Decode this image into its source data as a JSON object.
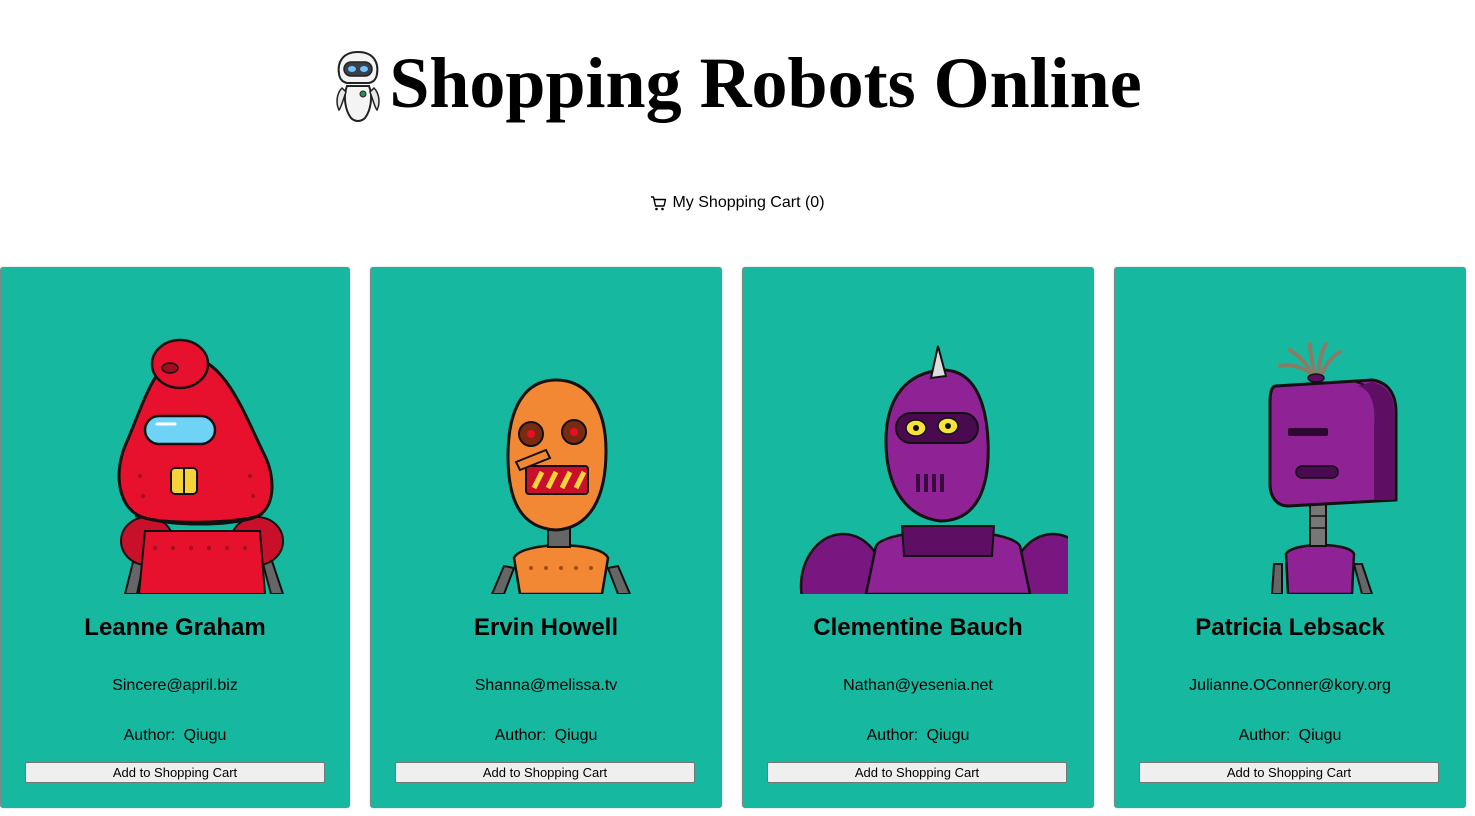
{
  "header": {
    "title": "Shopping Robots Online",
    "logo_icon": "robot-logo-icon"
  },
  "cart": {
    "label": "My Shopping Cart (0)",
    "icon": "shopping-cart-icon"
  },
  "colors": {
    "card_background": "#16b8a0",
    "robot_red": "#e8112d",
    "robot_orange": "#f28834",
    "robot_purple": "#8a1a8a"
  },
  "robots": [
    {
      "name": "Leanne Graham",
      "email": "Sincere@april.biz",
      "author_label": "Author:",
      "author": "Qiugu",
      "button": "Add to Shopping Cart",
      "image": "red-robot-image"
    },
    {
      "name": "Ervin Howell",
      "email": "Shanna@melissa.tv",
      "author_label": "Author:",
      "author": "Qiugu",
      "button": "Add to Shopping Cart",
      "image": "orange-robot-image"
    },
    {
      "name": "Clementine Bauch",
      "email": "Nathan@yesenia.net",
      "author_label": "Author:",
      "author": "Qiugu",
      "button": "Add to Shopping Cart",
      "image": "purple-spike-robot-image"
    },
    {
      "name": "Patricia Lebsack",
      "email": "Julianne.OConner@kory.org",
      "author_label": "Author:",
      "author": "Qiugu",
      "button": "Add to Shopping Cart",
      "image": "purple-bucket-robot-image"
    }
  ]
}
